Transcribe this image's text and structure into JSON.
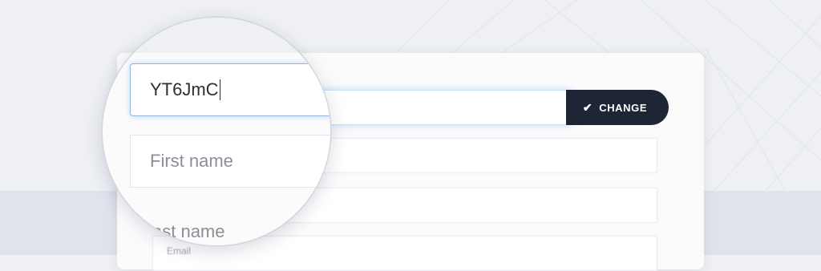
{
  "form": {
    "code_value": "YT6JmC",
    "change_label": "CHANGE",
    "first_name_placeholder": "First name",
    "last_name_placeholder": "ast name",
    "email_label": "Email"
  },
  "icons": {
    "check": "check-icon"
  },
  "colors": {
    "button_bg": "#1e2636",
    "button_text": "#ffffff",
    "focus_border": "#8fb4e6",
    "background": "#eef0f4"
  }
}
